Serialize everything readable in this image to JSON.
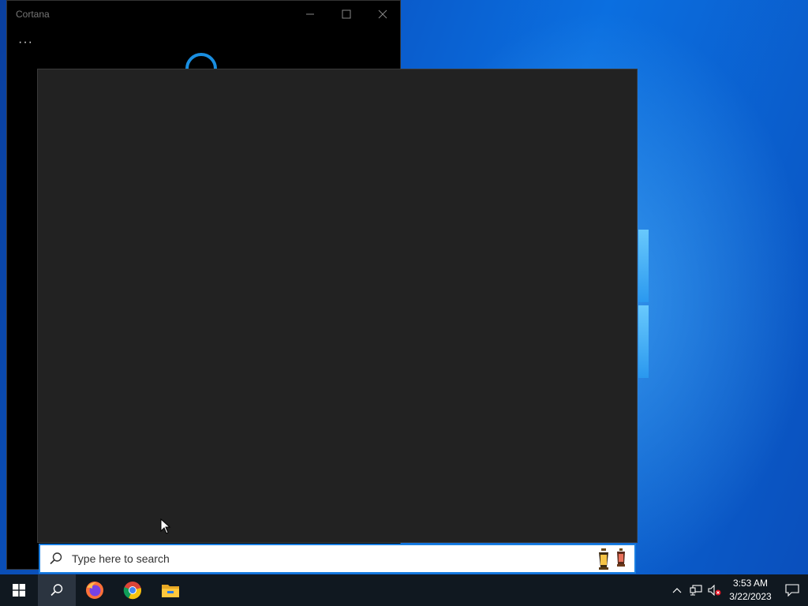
{
  "desktop": {
    "accent": "#0a5bd0"
  },
  "cortana_window": {
    "title": "Cortana",
    "controls": {
      "minimize": "—",
      "maximize": "☐",
      "close": "✕"
    },
    "more_label": "···"
  },
  "search": {
    "placeholder": "Type here to search",
    "accent": "#1a7ee0",
    "highlight_icons": [
      "lantern-icon",
      "lantern-icon"
    ]
  },
  "taskbar": {
    "apps": [
      {
        "name": "start-icon"
      },
      {
        "name": "search-icon"
      },
      {
        "name": "firefox-icon"
      },
      {
        "name": "chrome-icon"
      },
      {
        "name": "file-explorer-icon"
      }
    ],
    "tray": {
      "show_hidden": "^",
      "time": "3:53 AM",
      "date": "3/22/2023"
    }
  }
}
